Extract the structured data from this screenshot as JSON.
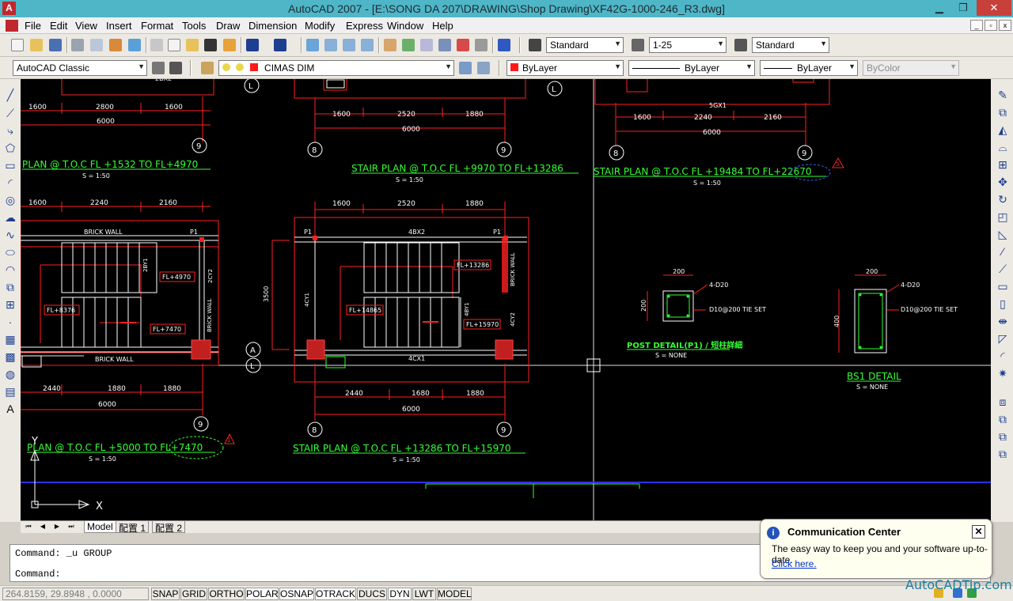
{
  "window": {
    "title": "AutoCAD 2007 - [E:\\SONG DA 207\\DRAWING\\Shop Drawing\\XF42G-1000-246_R3.dwg]",
    "minimize_glyph": "▁",
    "restore_glyph": "❐",
    "close_glyph": "✕",
    "app_icon_letter": "A"
  },
  "menu": {
    "items": [
      "File",
      "Edit",
      "View",
      "Insert",
      "Format",
      "Tools",
      "Draw",
      "Dimension",
      "Modify",
      "Express",
      "Window",
      "Help"
    ],
    "mdi_min": "_",
    "mdi_restore": "▫",
    "mdi_close": "x"
  },
  "toolbar1": {
    "text_style": "Standard",
    "dim_scale": "1-25",
    "table_style": "Standard"
  },
  "toolbar2": {
    "workspace": "AutoCAD Classic",
    "layer": "CIMAS DIM",
    "color": "ByLayer",
    "linetype": "ByLayer",
    "lineweight": "ByLayer",
    "plotstyle": "ByColor"
  },
  "drawing": {
    "views": [
      {
        "title": "PLAN @ T.O.C FL +1532 TO FL+4970",
        "scale": "S = 1:50"
      },
      {
        "title": "STAIR PLAN @ T.O.C FL +9970 TO FL+13286",
        "scale": "S = 1:50"
      },
      {
        "title": "STAIR PLAN @ T.O.C FL +19484 TO FL+22670",
        "scale": "S = 1:50"
      },
      {
        "title": "PLAN @ T.O.C FL +5000 TO FL+7470",
        "scale": "S = 1:50"
      },
      {
        "title": "STAIR PLAN @ T.O.C FL +13286 TO FL+15970",
        "scale": "S = 1:50"
      }
    ],
    "post_detail": {
      "title": "POST DETAIL(P1) / 短柱詳細",
      "scale": "S = NONE",
      "width": "200",
      "height": "200",
      "rebar": "4-D20",
      "tie": "D10@200 TIE SET"
    },
    "bs1_detail": {
      "title": "BS1 DETAIL",
      "scale": "S = NONE",
      "width": "200",
      "height": "400",
      "rebar": "4-D20",
      "tie": "D10@200 TIE SET"
    },
    "dims_top_left": [
      "1600",
      "2800",
      "1600",
      "6000"
    ],
    "dims_top_mid": [
      "1600",
      "2520",
      "1880",
      "6000"
    ],
    "dims_top_right": [
      "1600",
      "2240",
      "2160",
      "6000"
    ],
    "dims_mid_left": [
      "1600",
      "2240",
      "2160"
    ],
    "dims_mid_mid": [
      "1600",
      "2520",
      "1880"
    ],
    "dims_bot_left": [
      "2440",
      "1880",
      "1880",
      "6000"
    ],
    "dims_bot_mid": [
      "2440",
      "1680",
      "1880",
      "6000"
    ],
    "grid_bubbles": [
      "L",
      "L",
      "9",
      "8",
      "9",
      "8",
      "9",
      "A",
      "L",
      "9",
      "8",
      "9"
    ],
    "labels_left": [
      "BRICK WALL",
      "BRICK WALL",
      "P1",
      "FL+4970",
      "FL+8376",
      "FL+7470",
      "2BY1",
      "2CY2",
      "BRICK WALL"
    ],
    "labels_mid": [
      "P1",
      "P1",
      "4BX2",
      "4CY1",
      "4CX1",
      "4BY1",
      "4CY2",
      "FL+13286",
      "FL+14865",
      "FL+15970",
      "BRICK WALL",
      "3500"
    ],
    "top_cut_labels": [
      "5GX1"
    ],
    "revision_mark": "3",
    "revision_mark_2": "1",
    "ucs_x": "X",
    "ucs_y": "Y"
  },
  "layout_tabs": [
    "Model",
    "配置 1",
    "配置 2"
  ],
  "command": {
    "line1": "Command: _u GROUP",
    "line2": "Command:"
  },
  "status": {
    "coords": "264.8159, 29.8948 , 0.0000",
    "buttons": [
      "SNAP",
      "GRID",
      "ORTHO",
      "POLAR",
      "OSNAP",
      "OTRACK",
      "DUCS",
      "DYN",
      "LWT",
      "MODEL"
    ]
  },
  "comm_center": {
    "title": "Communication Center",
    "message": "The easy way to keep you and your software up-to-date.",
    "link": "Click here.",
    "close": "✕"
  },
  "watermark": "AutoCADTip.com",
  "colors": {
    "title_bar": "#4fb6c7",
    "canvas": "#000000",
    "cad_red": "#ff2020",
    "cad_green": "#33ff33",
    "cad_white": "#ffffff",
    "cad_blue": "#3030ff"
  }
}
